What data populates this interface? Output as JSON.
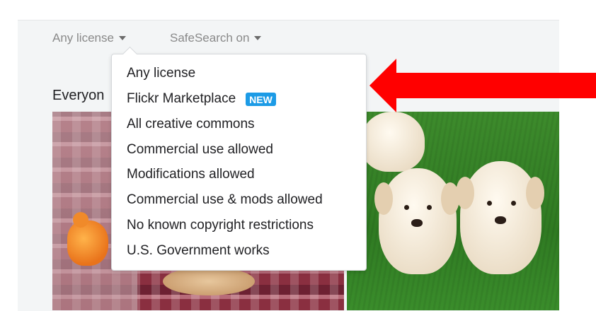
{
  "filters": {
    "license": "Any license",
    "safesearch": "SafeSearch on"
  },
  "section_title": "Everyon",
  "license_menu": {
    "items": [
      {
        "label": "Any license",
        "badge": ""
      },
      {
        "label": "Flickr Marketplace",
        "badge": "NEW"
      },
      {
        "label": "All creative commons",
        "badge": ""
      },
      {
        "label": "Commercial use allowed",
        "badge": ""
      },
      {
        "label": "Modifications allowed",
        "badge": ""
      },
      {
        "label": "Commercial use & mods allowed",
        "badge": ""
      },
      {
        "label": "No known copyright restrictions",
        "badge": ""
      },
      {
        "label": "U.S. Government works",
        "badge": ""
      }
    ]
  },
  "colors": {
    "badge": "#1c9be6",
    "arrow": "#ff0000",
    "text": "#212124",
    "muted": "#898989"
  },
  "icons": {
    "filter_caret": "caret-down-icon",
    "annotation": "red-arrow-icon"
  }
}
